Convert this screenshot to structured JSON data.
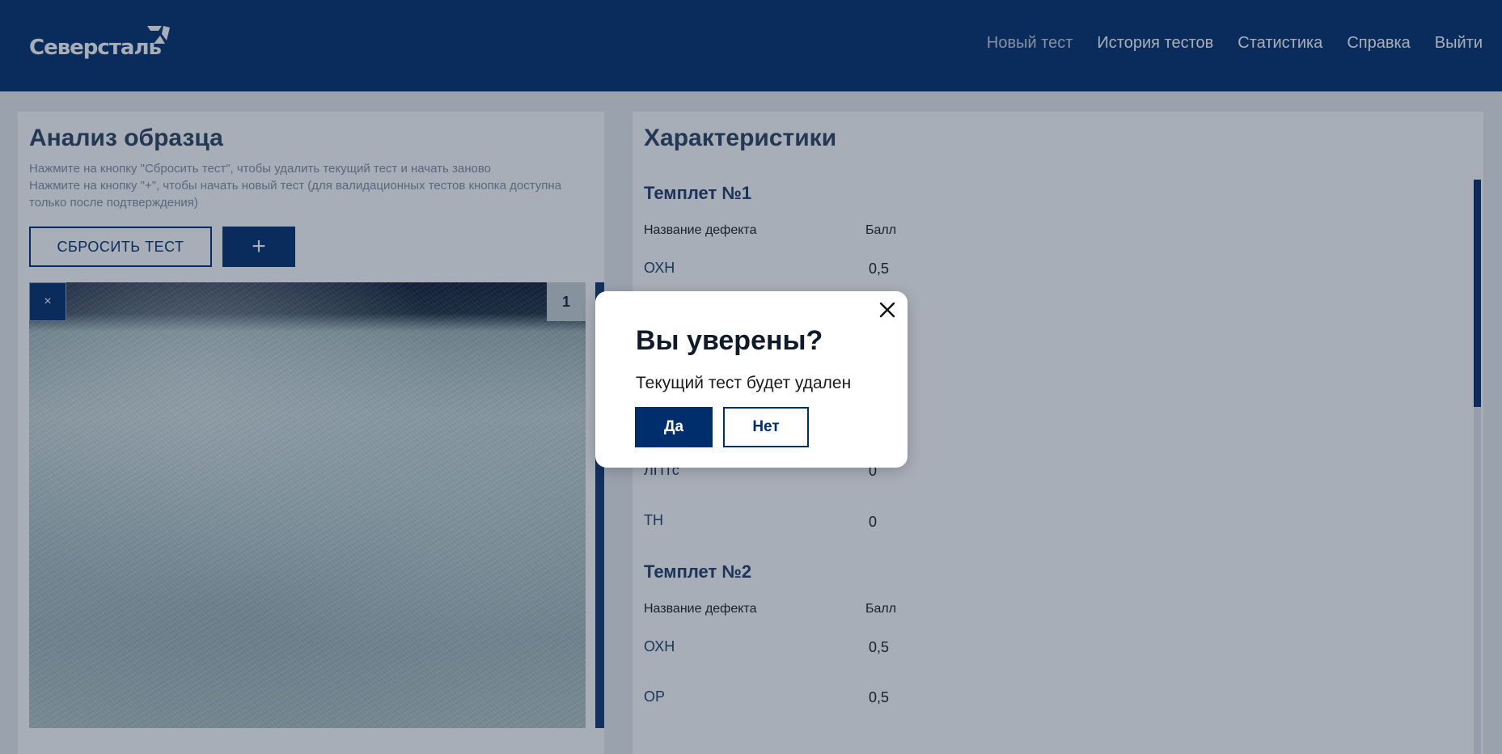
{
  "header": {
    "logo_text": "Северсталь",
    "nav": [
      {
        "label": "Новый тест"
      },
      {
        "label": "История тестов"
      },
      {
        "label": "Статистика"
      },
      {
        "label": "Справка"
      },
      {
        "label": "Выйти"
      }
    ]
  },
  "analysis": {
    "title": "Анализ образца",
    "hint_line1": "Нажмите на кнопку \"Сбросить тест\", чтобы удалить текущий тест и начать заново",
    "hint_line2": "Нажмите на кнопку \"+\", чтобы начать новый тест (для валидационных тестов кнопка доступна только после подтверждения)",
    "reset_label": "СБРОСИТЬ ТЕСТ",
    "add_label": "+",
    "image_close": "×",
    "image_number": "1"
  },
  "characteristics": {
    "title": "Характеристики",
    "templates": [
      {
        "title": "Темплет №1",
        "col_name": "Название дефекта",
        "col_score": "Балл",
        "rows": [
          {
            "name": "ОХН",
            "score": "0,5"
          },
          {
            "name": "ЛПТс",
            "score": "0"
          },
          {
            "name": "ТН",
            "score": "0"
          }
        ]
      },
      {
        "title": "Темплет №2",
        "col_name": "Название дефекта",
        "col_score": "Балл",
        "rows": [
          {
            "name": "ОХН",
            "score": "0,5"
          },
          {
            "name": "ОР",
            "score": "0,5"
          }
        ]
      }
    ]
  },
  "modal": {
    "title": "Вы уверены?",
    "text": "Текущий тест будет удален",
    "yes_label": "Да",
    "no_label": "Нет"
  },
  "colors": {
    "brand": "#002e6d",
    "overlay": "rgba(26,43,68,0.38)"
  }
}
